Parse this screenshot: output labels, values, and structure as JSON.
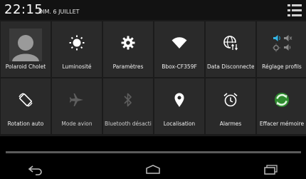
{
  "status": {
    "time": "22:15",
    "date": "DIM. 6 JUILLET"
  },
  "tiles": [
    {
      "label": "Polaroid Cholet",
      "icon": "avatar-icon"
    },
    {
      "label": "Luminosité",
      "icon": "brightness-icon"
    },
    {
      "label": "Paramètres",
      "icon": "settings-gear-icon"
    },
    {
      "label": "Bbox-CF359F",
      "icon": "wifi-icon"
    },
    {
      "label": "Data Disconnected",
      "icon": "mobile-data-globe-icon"
    },
    {
      "label": "Réglage profils",
      "icon": "sound-profile-icon"
    },
    {
      "label": "Rotation auto",
      "icon": "rotation-icon"
    },
    {
      "label": "Mode avion",
      "icon": "airplane-icon"
    },
    {
      "label": "Bluetooth désactivé",
      "icon": "bluetooth-icon"
    },
    {
      "label": "Localisation",
      "icon": "location-pin-icon"
    },
    {
      "label": "Alarmes",
      "icon": "alarm-clock-icon"
    },
    {
      "label": "Effacer mémoire",
      "icon": "clean-memory-icon"
    }
  ],
  "colors": {
    "tile": "#2a2a2a",
    "grid_bg": "#1b1b1b",
    "accent_green": "#3aa33a"
  }
}
